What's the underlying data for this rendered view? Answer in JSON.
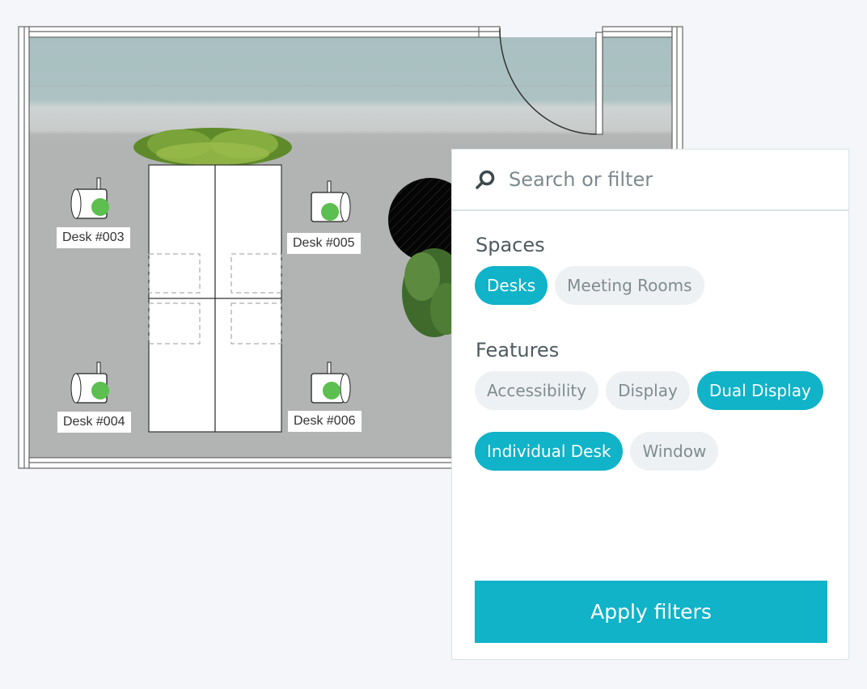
{
  "floorplan": {
    "desks": [
      {
        "id": "desk-003",
        "label": "Desk #003",
        "status": "available"
      },
      {
        "id": "desk-005",
        "label": "Desk #005",
        "status": "available"
      },
      {
        "id": "desk-004",
        "label": "Desk #004",
        "status": "available"
      },
      {
        "id": "desk-006",
        "label": "Desk #006",
        "status": "available"
      }
    ],
    "status_colors": {
      "available": "#5cbf4f"
    }
  },
  "filter_panel": {
    "search": {
      "placeholder": "Search or filter",
      "value": "",
      "icon": "search-icon"
    },
    "spaces": {
      "title": "Spaces",
      "options": [
        {
          "label": "Desks",
          "selected": true
        },
        {
          "label": "Meeting Rooms",
          "selected": false
        }
      ]
    },
    "features": {
      "title": "Features",
      "options": [
        {
          "label": "Accessibility",
          "selected": false
        },
        {
          "label": "Display",
          "selected": false
        },
        {
          "label": "Dual Display",
          "selected": true
        },
        {
          "label": "Individual Desk",
          "selected": true
        },
        {
          "label": "Window",
          "selected": false
        }
      ]
    },
    "apply_label": "Apply filters"
  },
  "colors": {
    "accent": "#10b3c8",
    "chip_inactive_bg": "#eef1f3",
    "chip_inactive_text": "#7f8c90"
  }
}
